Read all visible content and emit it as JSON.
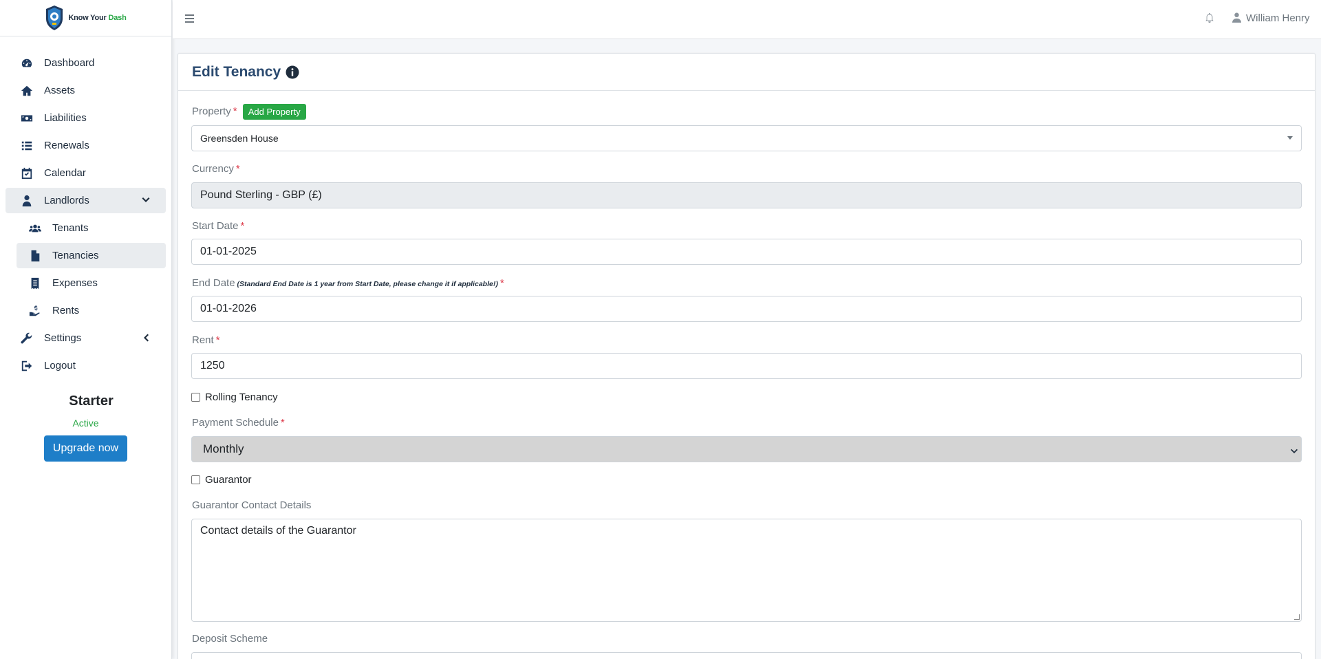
{
  "brand": {
    "name_part1": "Know Your ",
    "name_part2": "Dash"
  },
  "sidebar": {
    "items": [
      {
        "label": "Dashboard",
        "icon": "gauge-icon"
      },
      {
        "label": "Assets",
        "icon": "home-icon"
      },
      {
        "label": "Liabilities",
        "icon": "money-icon"
      },
      {
        "label": "Renewals",
        "icon": "list-icon"
      },
      {
        "label": "Calendar",
        "icon": "calendar-check-icon"
      },
      {
        "label": "Landlords",
        "icon": "user-tie-icon"
      },
      {
        "label": "Tenants",
        "icon": "users-icon"
      },
      {
        "label": "Tenancies",
        "icon": "file-contract-icon"
      },
      {
        "label": "Expenses",
        "icon": "receipt-icon"
      },
      {
        "label": "Rents",
        "icon": "hand-coin-icon"
      },
      {
        "label": "Settings",
        "icon": "wrench-icon"
      },
      {
        "label": "Logout",
        "icon": "sign-out-icon"
      }
    ],
    "plan": {
      "name": "Starter",
      "status": "Active",
      "upgrade_label": "Upgrade now"
    }
  },
  "header": {
    "username": "William Henry"
  },
  "form": {
    "title": "Edit Tenancy",
    "property": {
      "label": "Property",
      "add_label": "Add Property",
      "value": "Greensden House"
    },
    "currency": {
      "label": "Currency",
      "value": "Pound Sterling - GBP (£)"
    },
    "start_date": {
      "label": "Start Date",
      "value": "01-01-2025"
    },
    "end_date": {
      "label": "End Date",
      "hint": "(Standard End Date is 1 year from Start Date, please change it if applicable!)",
      "value": "01-01-2026"
    },
    "rent": {
      "label": "Rent",
      "value": "1250"
    },
    "rolling": {
      "label": "Rolling Tenancy"
    },
    "payment_schedule": {
      "label": "Payment Schedule",
      "value": "Monthly"
    },
    "guarantor": {
      "label": "Guarantor"
    },
    "guarantor_contact": {
      "label": "Guarantor Contact Details",
      "value": "Contact details of the Guarantor"
    },
    "deposit_scheme": {
      "label": "Deposit Scheme"
    },
    "required_mark": "*"
  },
  "colors": {
    "accent": "#1e7ec8",
    "success": "#28a745",
    "required": "#dc3545",
    "title": "#2b4a6f"
  }
}
